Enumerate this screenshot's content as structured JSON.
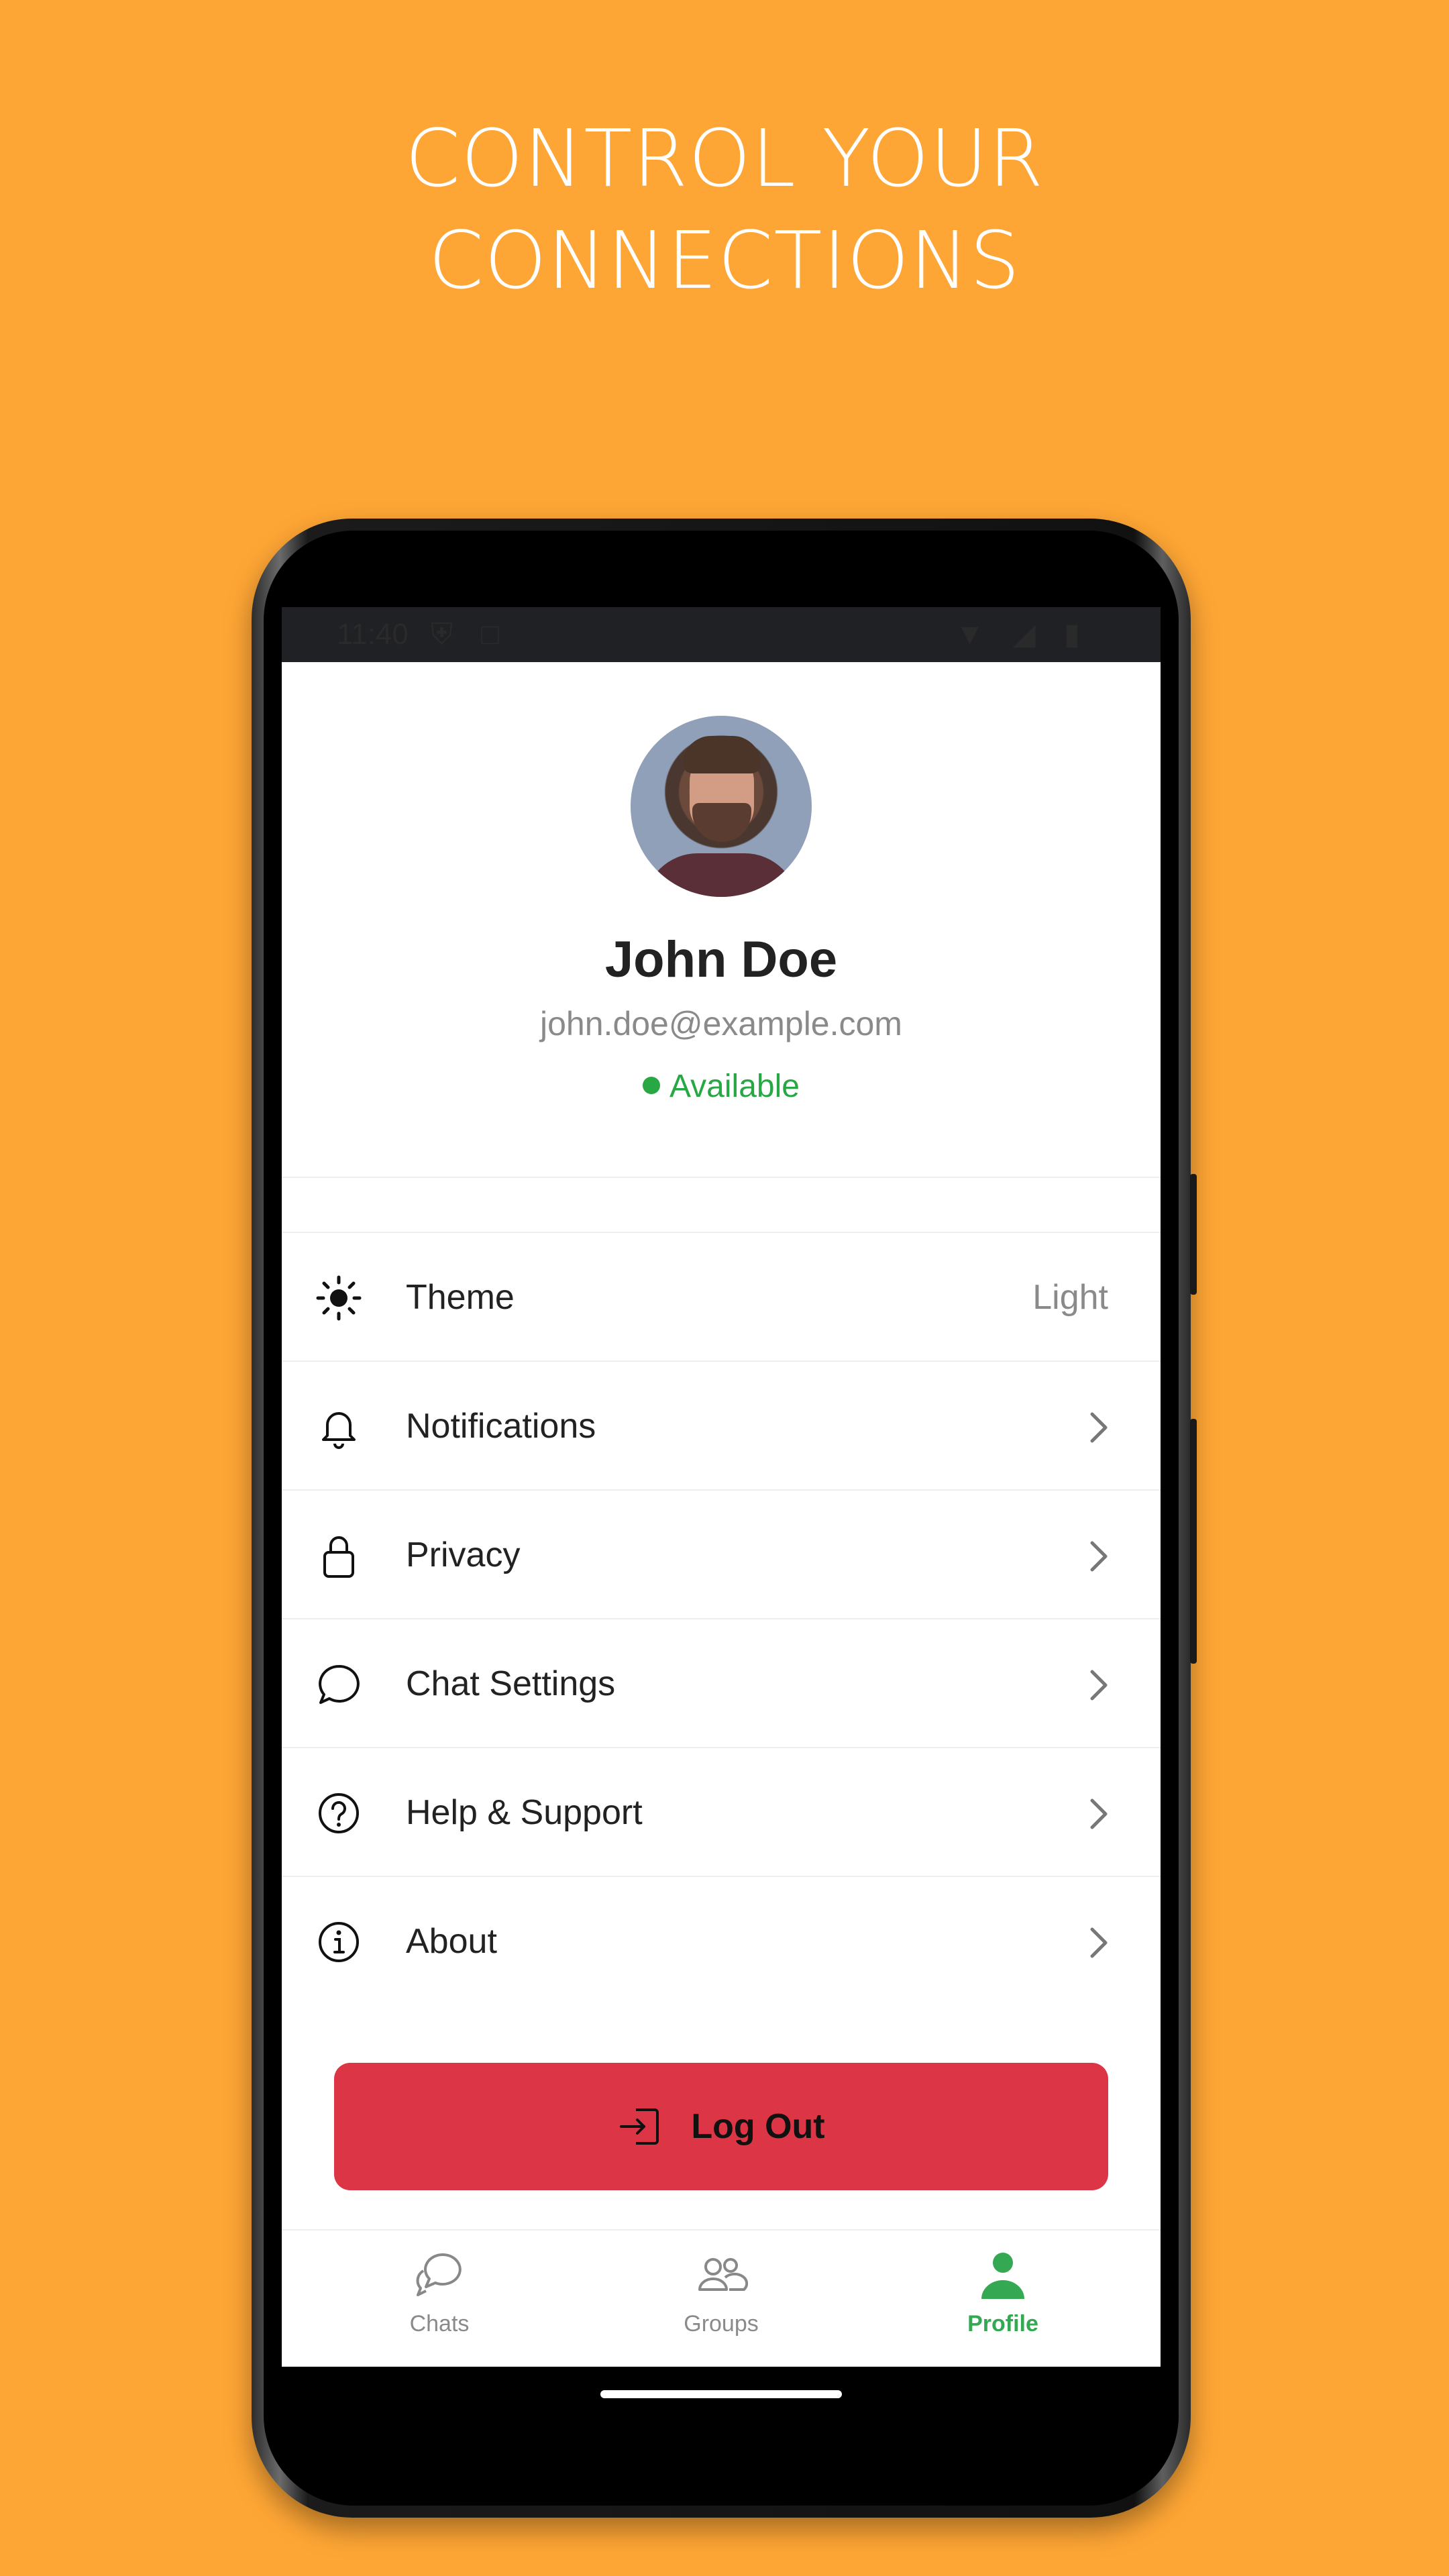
{
  "headline": {
    "line1": "CONTROL YOUR",
    "line2": "CONNECTIONS"
  },
  "status_bar": {
    "time": "11:40"
  },
  "profile": {
    "name": "John Doe",
    "email": "john.doe@example.com",
    "status": "Available",
    "status_color": "#28a745"
  },
  "menu": {
    "theme": {
      "label": "Theme",
      "value": "Light",
      "icon": "sun-icon"
    },
    "notifications": {
      "label": "Notifications",
      "icon": "bell-icon"
    },
    "privacy": {
      "label": "Privacy",
      "icon": "lock-icon"
    },
    "chat_settings": {
      "label": "Chat Settings",
      "icon": "chat-bubble-icon"
    },
    "help": {
      "label": "Help & Support",
      "icon": "help-circle-icon"
    },
    "about": {
      "label": "About",
      "icon": "info-icon"
    }
  },
  "logout": {
    "label": "Log Out",
    "color": "#DC3545",
    "icon": "logout-icon"
  },
  "tabs": {
    "chats": {
      "label": "Chats",
      "icon": "chats-icon"
    },
    "groups": {
      "label": "Groups",
      "icon": "groups-icon"
    },
    "profile": {
      "label": "Profile",
      "icon": "profile-icon",
      "active": true
    }
  },
  "colors": {
    "background": "#FEA635",
    "accent": "#34A853"
  }
}
